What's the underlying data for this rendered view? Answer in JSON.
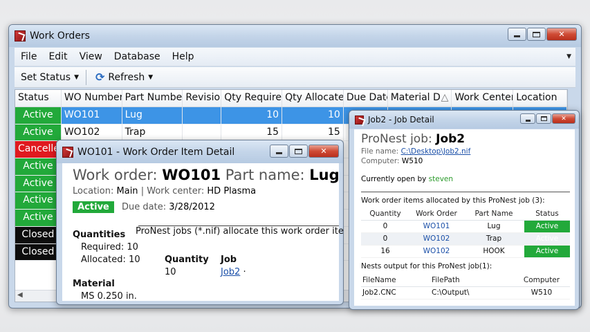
{
  "work_orders_window": {
    "title": "Work Orders",
    "menu": [
      "File",
      "Edit",
      "View",
      "Database",
      "Help"
    ],
    "toolbar": {
      "set_status": "Set Status",
      "refresh": "Refresh"
    },
    "columns": [
      "Status",
      "WO Number",
      "Part Number",
      "Revision",
      "Qty Required",
      "Qty Allocated",
      "Due Date",
      "Material D",
      "Work Center",
      "Location"
    ],
    "rows": [
      {
        "status": "Active",
        "wo": "WO101",
        "part": "Lug",
        "rev": "",
        "qty_req": "10",
        "qty_alloc": "10",
        "selected": true
      },
      {
        "status": "Active",
        "wo": "WO102",
        "part": "Trap",
        "rev": "",
        "qty_req": "15",
        "qty_alloc": "15",
        "selected": false
      },
      {
        "status": "Cancelled",
        "wo": "",
        "part": "",
        "rev": "",
        "qty_req": "",
        "qty_alloc": "",
        "selected": false
      },
      {
        "status": "Active",
        "wo": "",
        "part": "",
        "rev": "",
        "qty_req": "",
        "qty_alloc": "",
        "selected": false
      },
      {
        "status": "Active",
        "wo": "",
        "part": "",
        "rev": "",
        "qty_req": "",
        "qty_alloc": "",
        "selected": false
      },
      {
        "status": "Active",
        "wo": "",
        "part": "",
        "rev": "",
        "qty_req": "",
        "qty_alloc": "",
        "selected": false
      },
      {
        "status": "Active",
        "wo": "",
        "part": "",
        "rev": "",
        "qty_req": "",
        "qty_alloc": "",
        "selected": false
      },
      {
        "status": "Closed",
        "wo": "",
        "part": "",
        "rev": "",
        "qty_req": "",
        "qty_alloc": "",
        "selected": false
      },
      {
        "status": "Closed",
        "wo": "",
        "part": "",
        "rev": "",
        "qty_req": "",
        "qty_alloc": "",
        "selected": false
      }
    ],
    "sort_glyph": "△"
  },
  "item_detail_window": {
    "title": "WO101 - Work Order Item Detail",
    "work_order_label": "Work order:",
    "work_order_value": "WO101",
    "part_name_label": "Part name:",
    "part_name_value": "Lug",
    "location_label": "Location:",
    "location_value": "Main",
    "separator": "|",
    "work_center_label": "Work center:",
    "work_center_value": "HD Plasma",
    "status": "Active",
    "due_label": "Due date:",
    "due_value": "3/28/2012",
    "quantities_title": "Quantities",
    "required_label": "Required:",
    "required_value": "10",
    "allocated_label": "Allocated:",
    "allocated_value": "10",
    "pronest_note": "ProNest jobs (*.nif) allocate this work order item",
    "quantity_header": "Quantity",
    "job_header": "Job",
    "quantity_value": "10",
    "job_value": "Job2",
    "job_suffix": "·",
    "material_title": "Material",
    "material_value": "MS 0.250 in."
  },
  "job_detail_window": {
    "title": "Job2 - Job Detail",
    "job_label": "ProNest job:",
    "job_value": "Job2",
    "file_name_label": "File name:",
    "file_name_value": "C:\\Desktop\\Job2.nif",
    "computer_label": "Computer:",
    "computer_value": "W510",
    "open_by_label": "Currently open by",
    "open_by_value": "steven",
    "items_heading": "Work order items allocated by this ProNest job (3):",
    "items_columns": [
      "Quantity",
      "Work Order",
      "Part Name",
      "Status"
    ],
    "items": [
      {
        "qty": "0",
        "wo": "WO101",
        "part": "Lug",
        "status": "Active"
      },
      {
        "qty": "0",
        "wo": "WO102",
        "part": "Trap",
        "status": "Active"
      },
      {
        "qty": "16",
        "wo": "WO102",
        "part": "HOOK",
        "status": "Active"
      }
    ],
    "nests_heading": "Nests output for this ProNest job(1):",
    "nests_columns": [
      "FileName",
      "FilePath",
      "Computer"
    ],
    "nests": [
      {
        "file": "Job2.CNC",
        "path": "C:\\Output\\",
        "computer": "W510"
      }
    ]
  },
  "colors": {
    "active": "#22a93a",
    "cancelled": "#e0191f",
    "closed": "#0d0d0d",
    "selected_row": "#3d94e6",
    "link": "#1a4fa8"
  }
}
